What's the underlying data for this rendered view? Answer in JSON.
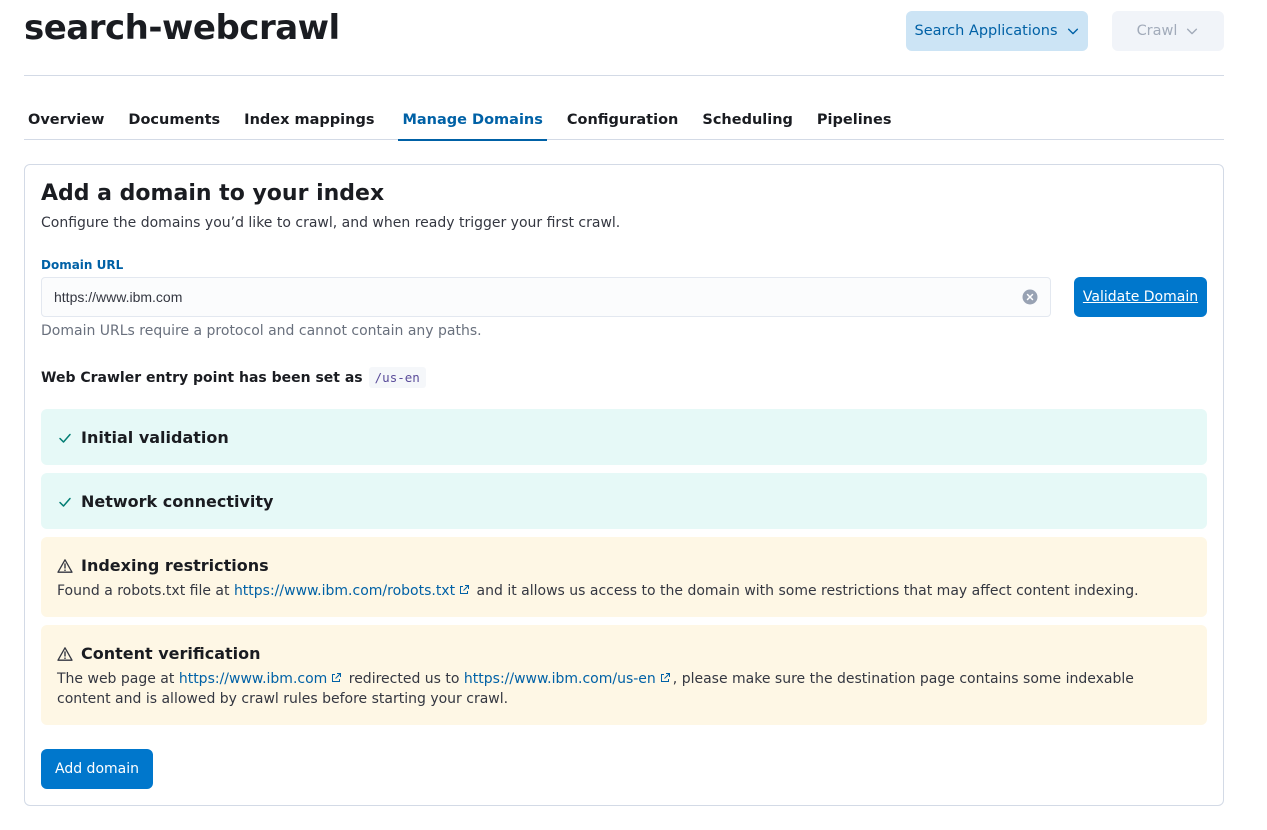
{
  "page": {
    "title": "search-webcrawl"
  },
  "header": {
    "search_applications_label": "Search Applications",
    "crawl_label": "Crawl"
  },
  "tabs": [
    {
      "label": "Overview",
      "active": false
    },
    {
      "label": "Documents",
      "active": false
    },
    {
      "label": "Index mappings",
      "active": false
    },
    {
      "label": "Manage Domains",
      "active": true
    },
    {
      "label": "Configuration",
      "active": false
    },
    {
      "label": "Scheduling",
      "active": false
    },
    {
      "label": "Pipelines",
      "active": false
    }
  ],
  "panel": {
    "title": "Add a domain to your index",
    "description": "Configure the domains you’d like to crawl, and when ready trigger your first crawl.",
    "field_label": "Domain URL",
    "domain_value": "https://www.ibm.com",
    "validate_label": "Validate Domain",
    "help_text": "Domain URLs require a protocol and cannot contain any paths.",
    "entry_point_text": "Web Crawler entry point has been set as",
    "entry_point_path": "/us-en",
    "add_domain_label": "Add domain"
  },
  "checks": {
    "initial_validation": {
      "title": "Initial validation",
      "status": "success"
    },
    "network_connectivity": {
      "title": "Network connectivity",
      "status": "success"
    },
    "indexing_restrictions": {
      "title": "Indexing restrictions",
      "status": "warning",
      "text_before": "Found a robots.txt file at ",
      "link": "https://www.ibm.com/robots.txt",
      "text_after": " and it allows us access to the domain with some restrictions that may affect content indexing."
    },
    "content_verification": {
      "title": "Content verification",
      "status": "warning",
      "text_before": "The web page at ",
      "link1": "https://www.ibm.com",
      "text_middle": " redirected us to ",
      "link2": "https://www.ibm.com/us-en",
      "text_after": ", please make sure the destination page contains some indexable content and is allowed by crawl rules before starting your crawl."
    }
  },
  "colors": {
    "primary": "#0077cc",
    "link": "#0061a6",
    "success_bg": "#e6f9f7",
    "success_icon": "#017d73",
    "warning_bg": "#fef7e5",
    "warning_icon": "#343741"
  }
}
